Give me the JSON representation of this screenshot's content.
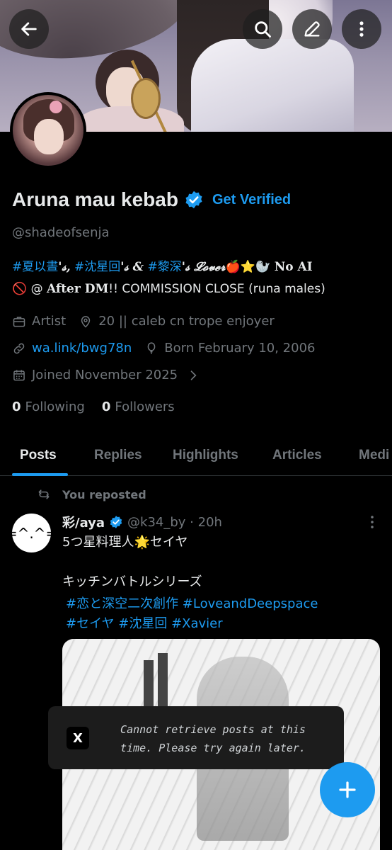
{
  "header": {
    "back_icon": "arrow-left-icon",
    "search_icon": "search-icon",
    "edit_icon": "pencil-icon",
    "more_icon": "more-vertical-icon"
  },
  "profile": {
    "name": "Aruna mau kebab",
    "get_verified": "Get Verified",
    "handle": "@shadeofsenja",
    "bio_tag1": "#夏以晝",
    "bio_tag1_suffix": "'𝓈,",
    "bio_tag2": "#沈星回",
    "bio_tag2_suffix": "'𝓈 &",
    "bio_tag3": "#黎深",
    "bio_tag3_suffix": "'𝓈 𝓛𝓸𝓿𝓮𝓻",
    "bio_emojis": "🍎⭐🦭",
    "bio_no_ai": "No AI",
    "bio_line2_emoji": "🚫",
    "bio_at": "@",
    "bio_after_dm": "After DM",
    "bio_line2_rest": "!! COMMISSION CLOSE (runa males)",
    "category": "Artist",
    "location": "20 || caleb cn trope enjoyer",
    "website": "wa.link/bwg78n",
    "birthday": "Born February 10, 2006",
    "joined": "Joined November 2025",
    "following_count": "0",
    "following_label": "Following",
    "followers_count": "0",
    "followers_label": "Followers"
  },
  "tabs": [
    "Posts",
    "Replies",
    "Highlights",
    "Articles",
    "Medi"
  ],
  "post": {
    "repost_label": "You reposted",
    "author_name": "彩/aya",
    "author_meta": "@k34_by · 20h",
    "avatar_glyph": "=^.^=",
    "text_line1": "5つ星料理人🌟セイヤ",
    "text_line2": "キッチンバトルシリーズ",
    "tags_line1": "#恋と深空二次創作 #LoveandDeepspace",
    "tags_line2": "#セイヤ #沈星回 #Xavier"
  },
  "toast": {
    "logo": "X",
    "message": "Cannot retrieve posts at this time. Please try again later."
  },
  "colors": {
    "accent": "#1d9bf0",
    "background": "#000000",
    "muted": "#71767b"
  }
}
